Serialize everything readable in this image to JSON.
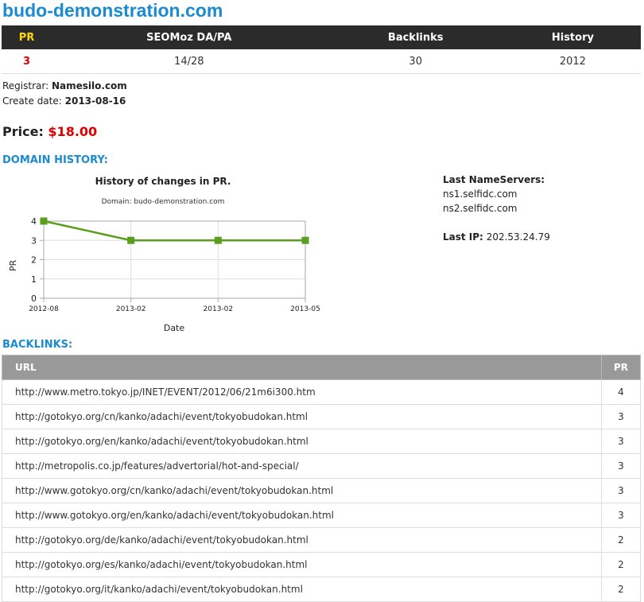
{
  "site": {
    "title": "budo-demonstration.com"
  },
  "stats": {
    "headers": [
      "PR",
      "SEOMoz DA/PA",
      "Backlinks",
      "History"
    ],
    "values": [
      "3",
      "14/28",
      "30",
      "2012"
    ]
  },
  "registrar": {
    "label": "Registrar:",
    "value": "Namesilo.com"
  },
  "create_date": {
    "label": "Create date:",
    "value": "2013-08-16"
  },
  "price": {
    "label": "Price:",
    "value": "$18.00"
  },
  "domain_history": {
    "title": "DOMAIN HISTORY:"
  },
  "chart_data": {
    "type": "line",
    "title": "History of changes in PR.",
    "subtitle": "Domain: budo-demonstration.com",
    "xlabel": "Date",
    "ylabel": "PR",
    "categories": [
      "2012-08",
      "2013-02",
      "2013-02",
      "2013-05"
    ],
    "values": [
      4,
      3,
      3,
      3
    ],
    "ylim": [
      0,
      4
    ],
    "yticks": [
      "0",
      "1",
      "2",
      "3",
      "4"
    ],
    "grid": true,
    "color": "#5a9e1e"
  },
  "nameservers": {
    "label": "Last NameServers:",
    "items": [
      "ns1.selfidc.com",
      "ns2.selfidc.com"
    ]
  },
  "last_ip": {
    "label": "Last IP:",
    "value": "202.53.24.79"
  },
  "backlinks": {
    "title": "BACKLINKS:",
    "headers": [
      "URL",
      "PR"
    ],
    "rows": [
      {
        "url": "http://www.metro.tokyo.jp/INET/EVENT/2012/06/21m6i300.htm",
        "pr": "4"
      },
      {
        "url": "http://gotokyo.org/cn/kanko/adachi/event/tokyobudokan.html",
        "pr": "3"
      },
      {
        "url": "http://gotokyo.org/en/kanko/adachi/event/tokyobudokan.html",
        "pr": "3"
      },
      {
        "url": "http://metropolis.co.jp/features/advertorial/hot-and-special/",
        "pr": "3"
      },
      {
        "url": "http://www.gotokyo.org/cn/kanko/adachi/event/tokyobudokan.html",
        "pr": "3"
      },
      {
        "url": "http://www.gotokyo.org/en/kanko/adachi/event/tokyobudokan.html",
        "pr": "3"
      },
      {
        "url": "http://gotokyo.org/de/kanko/adachi/event/tokyobudokan.html",
        "pr": "2"
      },
      {
        "url": "http://gotokyo.org/es/kanko/adachi/event/tokyobudokan.html",
        "pr": "2"
      },
      {
        "url": "http://gotokyo.org/it/kanko/adachi/event/tokyobudokan.html",
        "pr": "2"
      }
    ]
  }
}
